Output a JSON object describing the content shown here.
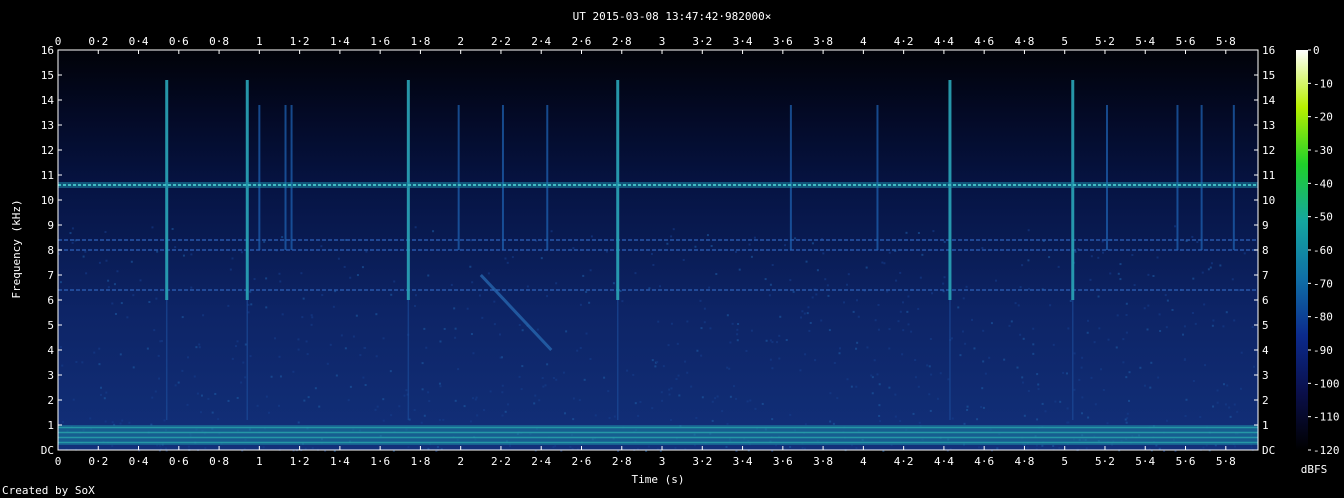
{
  "chart_data": {
    "type": "heatmap",
    "title": "UT 2015-03-08 13:47:42·982000×",
    "xlabel": "Time (s)",
    "ylabel": "Frequency (kHz)",
    "xlim": [
      0,
      5.96
    ],
    "ylim": [
      0,
      16
    ],
    "x_ticks": [
      "0",
      "0·2",
      "0·4",
      "0·6",
      "0·8",
      "1",
      "1·2",
      "1·4",
      "1·6",
      "1·8",
      "2",
      "2·2",
      "2·4",
      "2·6",
      "2·8",
      "3",
      "3·2",
      "3·4",
      "3·6",
      "3·8",
      "4",
      "4·2",
      "4·4",
      "4·6",
      "4·8",
      "5",
      "5·2",
      "5·4",
      "5·6",
      "5·8"
    ],
    "y_ticks": [
      "DC",
      "1",
      "2",
      "3",
      "4",
      "5",
      "6",
      "7",
      "8",
      "9",
      "10",
      "11",
      "12",
      "13",
      "14",
      "15",
      "16"
    ],
    "colorbar": {
      "label": "dBFS",
      "ticks": [
        "0",
        "-10",
        "-20",
        "-30",
        "-40",
        "-50",
        "-60",
        "-70",
        "-80",
        "-90",
        "-100",
        "-110",
        "-120"
      ],
      "range": [
        -120,
        0
      ],
      "colors": [
        "#000000",
        "#0a0f4a",
        "#0b2a8c",
        "#0f6fa6",
        "#14a6a0",
        "#1fd02a",
        "#b8f000",
        "#ffffff"
      ]
    },
    "features": {
      "tone_khz": 10.6,
      "weak_tones_khz": [
        8.0,
        8.4,
        6.4
      ],
      "low_band_khz": [
        0.2,
        1.0
      ],
      "impulses_s": [
        0.54,
        0.94,
        1.0,
        1.13,
        1.16,
        1.74,
        1.99,
        2.21,
        2.43,
        2.78,
        3.64,
        4.07,
        4.43,
        5.04,
        5.21,
        5.56,
        5.68,
        5.84
      ],
      "strong_impulses_s": [
        0.54,
        0.94,
        1.14,
        1.74,
        2.78,
        4.43,
        5.04
      ],
      "chirp": {
        "from": [
          2.1,
          7.0
        ],
        "to": [
          2.45,
          4.0
        ]
      }
    },
    "grid": false
  },
  "footer": {
    "credit": "Created by SoX"
  }
}
